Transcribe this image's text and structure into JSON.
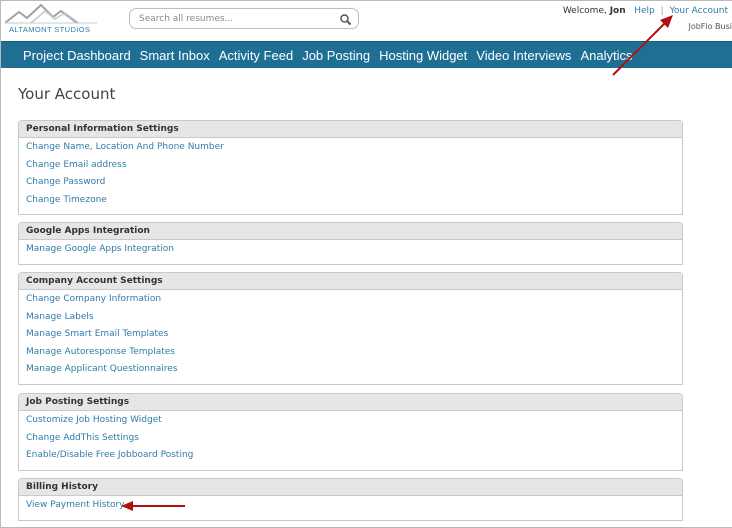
{
  "brand": {
    "logo_text": "ALTAMONT STUDIOS"
  },
  "search": {
    "placeholder": "Search all resumes..."
  },
  "header": {
    "welcome_prefix": "Welcome, ",
    "user_name": "Jon",
    "help_label": "Help",
    "separator": "|",
    "account_label": "Your Account",
    "subbrand": "JobFlo Busi"
  },
  "nav": {
    "items": [
      {
        "label": "Project Dashboard"
      },
      {
        "label": "Smart Inbox"
      },
      {
        "label": "Activity Feed"
      },
      {
        "label": "Job Posting"
      },
      {
        "label": "Hosting Widget"
      },
      {
        "label": "Video Interviews"
      },
      {
        "label": "Analytics"
      }
    ]
  },
  "page": {
    "title": "Your Account"
  },
  "sections": [
    {
      "title": "Personal Information Settings",
      "links": [
        "Change Name, Location And Phone Number",
        "Change Email address",
        "Change Password",
        "Change Timezone"
      ]
    },
    {
      "title": "Google Apps Integration",
      "links": [
        "Manage Google Apps Integration"
      ]
    },
    {
      "title": "Company Account Settings",
      "links": [
        "Change Company Information",
        "Manage Labels",
        "Manage Smart Email Templates",
        "Manage Autoresponse Templates",
        "Manage Applicant Questionnaires"
      ]
    },
    {
      "title": "Job Posting Settings",
      "links": [
        "Customize Job Hosting Widget",
        "Change AddThis Settings",
        "Enable/Disable Free Jobboard Posting"
      ]
    },
    {
      "title": "Billing History",
      "links": [
        "View Payment History"
      ]
    }
  ],
  "colors": {
    "nav_bg": "#1f6f95",
    "link": "#2f7ca8",
    "annotation_arrow": "#b01010"
  },
  "icons": {
    "search": "magnifier-icon"
  }
}
